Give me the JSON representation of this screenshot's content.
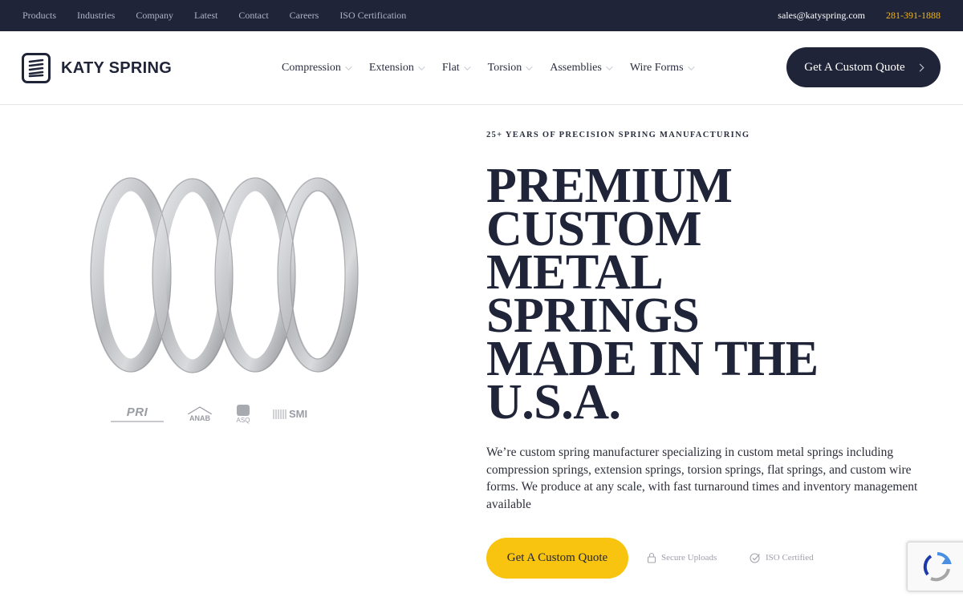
{
  "topbar": {
    "links": [
      "Products",
      "Industries",
      "Company",
      "Latest",
      "Contact",
      "Careers",
      "ISO Certification"
    ],
    "email": "sales@katyspring.com",
    "phone": "281-391-1888"
  },
  "header": {
    "logo_text": "KATY SPRING",
    "nav": [
      "Compression",
      "Extension",
      "Flat",
      "Torsion",
      "Assemblies",
      "Wire Forms"
    ],
    "quote_label": "Get A Custom Quote"
  },
  "hero": {
    "eyebrow": "25+ YEARS OF PRECISION SPRING MANUFACTURING",
    "headline_lines": [
      "PREMIUM",
      "CUSTOM",
      "METAL",
      "SPRINGS",
      "MADE IN THE",
      "U.S.A."
    ],
    "description": "We’re custom spring manufacturer specializing in custom metal springs including compression springs, extension springs, torsion springs, flat springs, and custom wire forms. We produce at any scale, with fast turnaround times and inventory management available",
    "cta_label": "Get A Custom Quote",
    "badges": [
      "Secure Uploads",
      "ISO Certified"
    ]
  },
  "certifications": [
    {
      "name": "PRI",
      "icon": "pri-logo"
    },
    {
      "name": "ANAB",
      "icon": "anab-logo"
    },
    {
      "name": "ASQ",
      "icon": "asq-logo"
    },
    {
      "name": "SMI",
      "icon": "smi-logo"
    }
  ],
  "colors": {
    "navy": "#1f2438",
    "accent_yellow": "#f9c40f",
    "phone_orange": "#f5b81b"
  }
}
